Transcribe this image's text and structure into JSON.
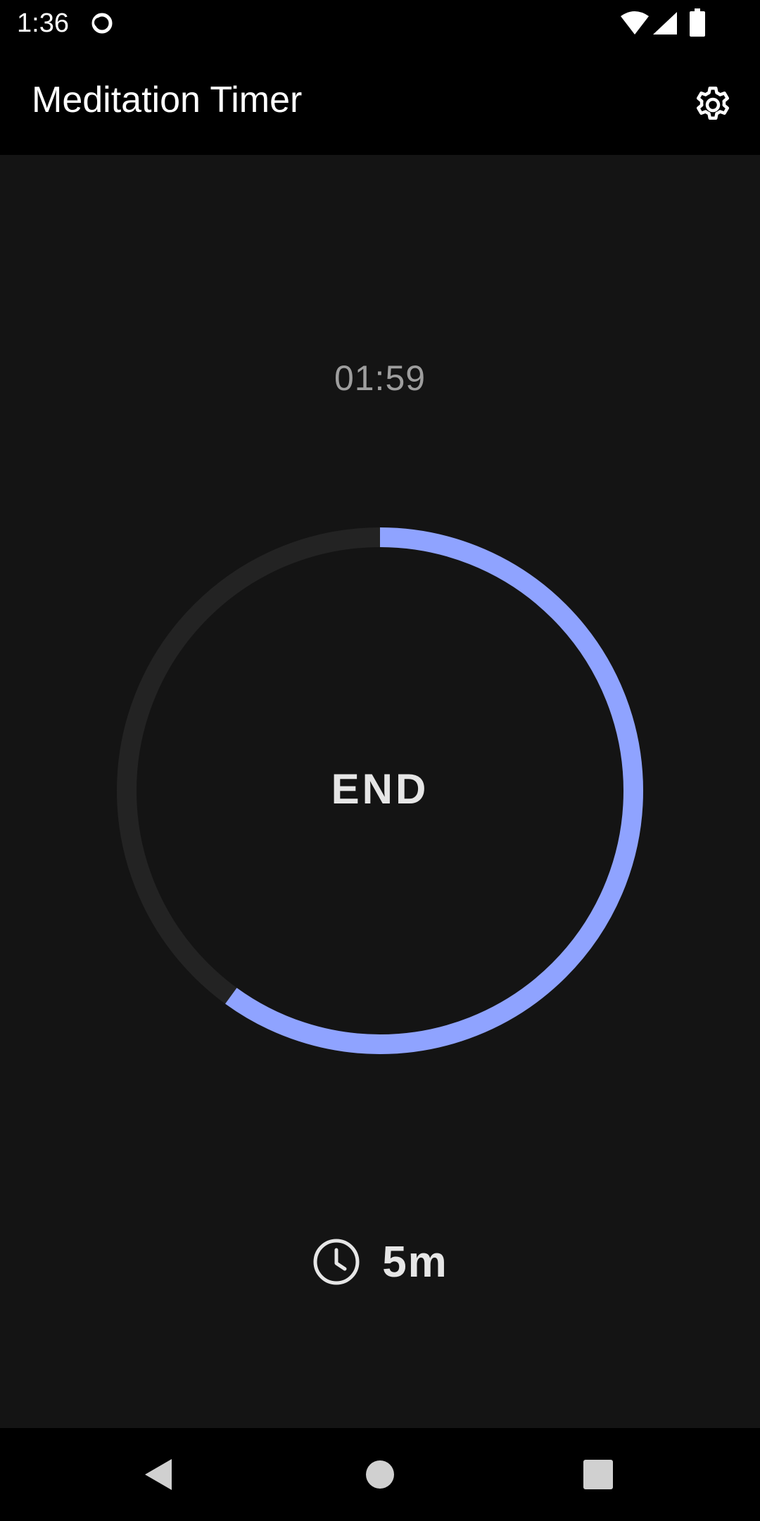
{
  "status_bar": {
    "time": "1:36",
    "icons": [
      "circle-notification-icon",
      "wifi-icon",
      "signal-icon",
      "battery-icon"
    ]
  },
  "app_bar": {
    "title": "Meditation Timer",
    "settings_icon": "gear-icon"
  },
  "timer": {
    "elapsed": "01:59",
    "button_label": "END",
    "progress_fraction": 0.6,
    "duration_label": "5m",
    "duration_icon": "clock-icon"
  },
  "nav_bar": {
    "items": [
      "back-icon",
      "home-icon",
      "recents-icon"
    ]
  },
  "colors": {
    "background": "#141414",
    "bar": "#000000",
    "accent": "#8fa3ff",
    "track": "#232323",
    "muted_text": "#9e9e9e",
    "primary_text": "#e6e6e6"
  }
}
